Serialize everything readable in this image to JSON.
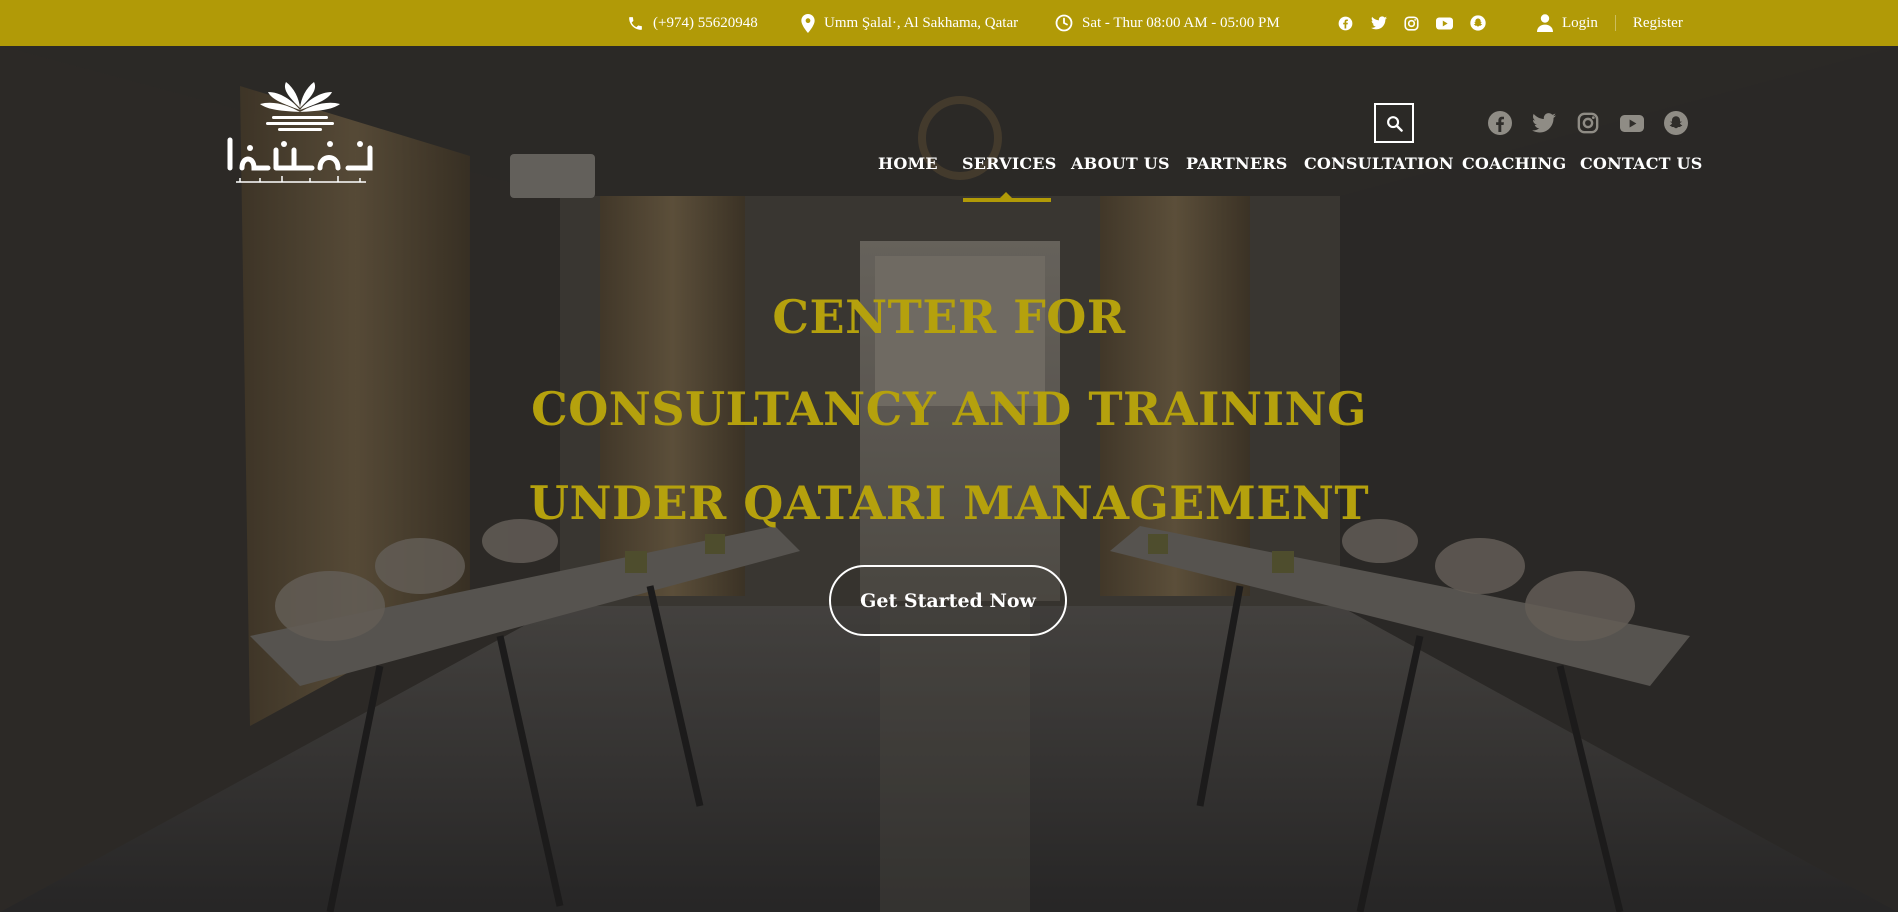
{
  "topbar": {
    "phone": "(+974) 55620948",
    "address": "Umm Şalal·, Al Sakhama, Qatar",
    "hours": "Sat - Thur 08:00 AM - 05:00 PM",
    "social_icons": [
      "facebook-icon",
      "twitter-icon",
      "instagram-icon",
      "youtube-icon",
      "snapchat-icon"
    ],
    "login": "Login",
    "register": "Register"
  },
  "header": {
    "logo_alt": "Etizan logo",
    "social_icons": [
      "facebook-icon",
      "twitter-icon",
      "instagram-icon",
      "youtube-icon",
      "snapchat-icon"
    ],
    "search_icon": "search-icon"
  },
  "nav": {
    "items": [
      {
        "label": "HOME"
      },
      {
        "label": "SERVICES",
        "active": true
      },
      {
        "label": "ABOUT US"
      },
      {
        "label": "PARTNERS"
      },
      {
        "label": "CONSULTATION"
      },
      {
        "label": "COACHING"
      },
      {
        "label": "CONTACT US"
      }
    ]
  },
  "hero": {
    "line1": "CENTER FOR",
    "line2": "CONSULTANCY AND TRAINING",
    "line3": "UNDER QATARI MANAGEMENT",
    "cta_label": "Get Started Now"
  },
  "colors": {
    "accent": "#b19a07",
    "headline": "#b5a10d",
    "text": "#ffffff"
  }
}
